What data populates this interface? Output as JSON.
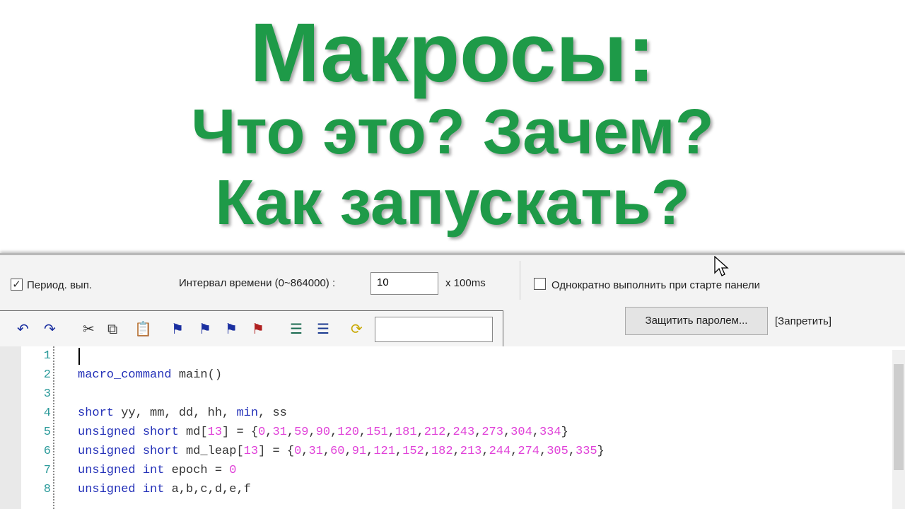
{
  "title": {
    "line1": "Макросы:",
    "line2": "Что это? Зачем?",
    "line3": "Как запускать?"
  },
  "options": {
    "periodic_label": "Период. вып.",
    "periodic_checked": true,
    "interval_label": "Интервал времени (0~864000) :",
    "interval_value": "10",
    "interval_unit": "x 100ms",
    "run_once_label": "Однократно выполнить при старте панели",
    "run_once_checked": false
  },
  "toolbar": {
    "icons": [
      "undo-icon",
      "redo-icon",
      "cut-icon",
      "copy-icon",
      "paste-icon",
      "bookmark-icon",
      "next-bookmark-icon",
      "prev-bookmark-icon",
      "clear-bookmarks-icon",
      "indent-icon",
      "outdent-icon",
      "find-replace-icon"
    ],
    "search_value": ""
  },
  "protect": {
    "button_label": "Защитить паролем...",
    "status": "[Запретить]"
  },
  "code": {
    "lines": [
      {
        "num": "1",
        "tokens": []
      },
      {
        "num": "2",
        "tokens": [
          [
            "k",
            "macro_command"
          ],
          [
            "i",
            " main()"
          ]
        ]
      },
      {
        "num": "3",
        "tokens": []
      },
      {
        "num": "4",
        "tokens": [
          [
            "k",
            "short"
          ],
          [
            "i",
            " yy, mm, dd, hh, "
          ],
          [
            "k",
            "min"
          ],
          [
            "i",
            ", ss"
          ]
        ]
      },
      {
        "num": "5",
        "tokens": [
          [
            "k",
            "unsigned short"
          ],
          [
            "i",
            " md["
          ],
          [
            "n",
            "13"
          ],
          [
            "i",
            "] = {"
          ],
          [
            "n",
            "0"
          ],
          [
            "i",
            ","
          ],
          [
            "n",
            "31"
          ],
          [
            "i",
            ","
          ],
          [
            "n",
            "59"
          ],
          [
            "i",
            ","
          ],
          [
            "n",
            "90"
          ],
          [
            "i",
            ","
          ],
          [
            "n",
            "120"
          ],
          [
            "i",
            ","
          ],
          [
            "n",
            "151"
          ],
          [
            "i",
            ","
          ],
          [
            "n",
            "181"
          ],
          [
            "i",
            ","
          ],
          [
            "n",
            "212"
          ],
          [
            "i",
            ","
          ],
          [
            "n",
            "243"
          ],
          [
            "i",
            ","
          ],
          [
            "n",
            "273"
          ],
          [
            "i",
            ","
          ],
          [
            "n",
            "304"
          ],
          [
            "i",
            ","
          ],
          [
            "n",
            "334"
          ],
          [
            "i",
            "}"
          ]
        ]
      },
      {
        "num": "6",
        "tokens": [
          [
            "k",
            "unsigned short"
          ],
          [
            "i",
            " md_leap["
          ],
          [
            "n",
            "13"
          ],
          [
            "i",
            "] = {"
          ],
          [
            "n",
            "0"
          ],
          [
            "i",
            ","
          ],
          [
            "n",
            "31"
          ],
          [
            "i",
            ","
          ],
          [
            "n",
            "60"
          ],
          [
            "i",
            ","
          ],
          [
            "n",
            "91"
          ],
          [
            "i",
            ","
          ],
          [
            "n",
            "121"
          ],
          [
            "i",
            ","
          ],
          [
            "n",
            "152"
          ],
          [
            "i",
            ","
          ],
          [
            "n",
            "182"
          ],
          [
            "i",
            ","
          ],
          [
            "n",
            "213"
          ],
          [
            "i",
            ","
          ],
          [
            "n",
            "244"
          ],
          [
            "i",
            ","
          ],
          [
            "n",
            "274"
          ],
          [
            "i",
            ","
          ],
          [
            "n",
            "305"
          ],
          [
            "i",
            ","
          ],
          [
            "n",
            "335"
          ],
          [
            "i",
            "}"
          ]
        ]
      },
      {
        "num": "7",
        "tokens": [
          [
            "k",
            "unsigned int"
          ],
          [
            "i",
            " epoch = "
          ],
          [
            "n",
            "0"
          ]
        ]
      },
      {
        "num": "8",
        "tokens": [
          [
            "k",
            "unsigned int"
          ],
          [
            "i",
            " a,b,c,d,e,f"
          ]
        ]
      }
    ]
  }
}
